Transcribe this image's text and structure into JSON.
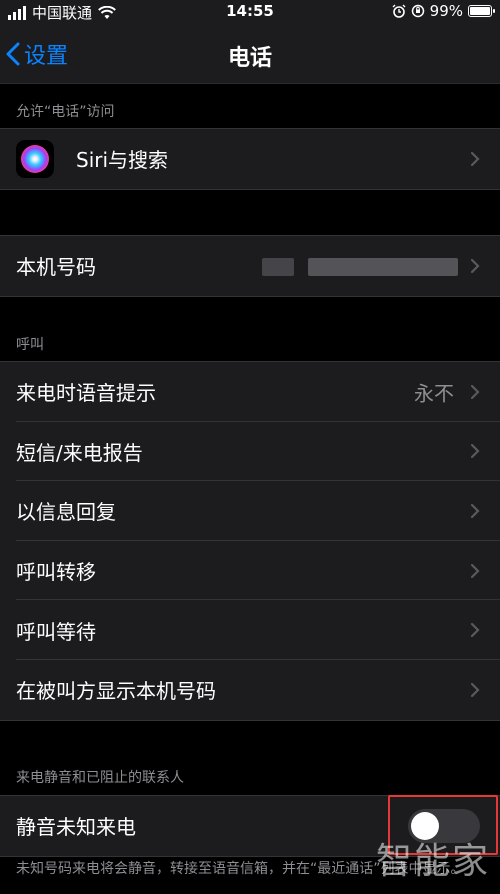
{
  "status_bar": {
    "carrier": "中国联通",
    "time": "14:55",
    "battery": "99%",
    "battery_level": 0.99
  },
  "nav": {
    "back_label": "设置",
    "title": "电话"
  },
  "sections": {
    "allow_access_header": "允许“电话”访问",
    "siri_label": "Siri与搜索",
    "my_number_label": "本机号码",
    "calls_header": "呼叫",
    "announce_calls": {
      "label": "来电时语音提示",
      "value": "永不"
    },
    "sms_call_reporting": "短信/来电报告",
    "respond_with_text": "以信息回复",
    "call_forwarding": "呼叫转移",
    "call_waiting": "呼叫等待",
    "show_caller_id": "在被叫方显示本机号码",
    "silence_header": "来电静音和已阻止的联系人",
    "silence_unknown": {
      "label": "静音未知来电",
      "enabled": false
    },
    "footer": "未知号码来电将会静音，转接至语音信箱，并在“最近通话”列表中显示。"
  },
  "watermark": "智能家",
  "colors": {
    "accent": "#0a84ff",
    "highlight": "#e53935"
  }
}
